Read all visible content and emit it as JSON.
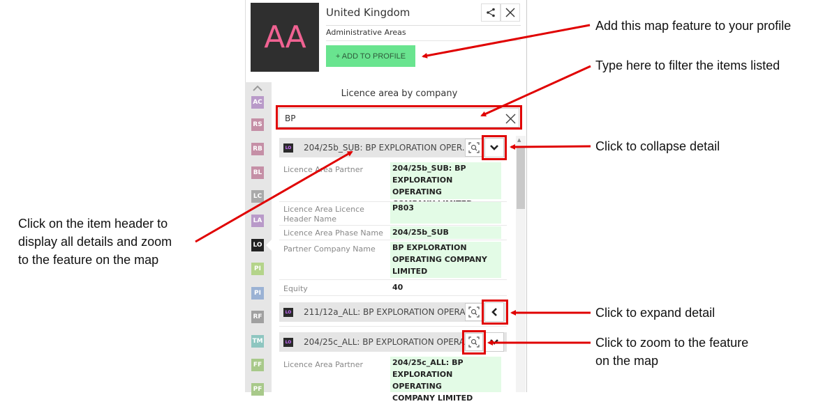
{
  "header": {
    "thumbnail_text": "AA",
    "title": "United Kingdom",
    "subtitle": "Administrative Areas",
    "add_button": "+ ADD TO PROFILE"
  },
  "rail": {
    "items": [
      "AC",
      "RS",
      "RB",
      "BL",
      "LC",
      "LA",
      "LO",
      "PI",
      "PI",
      "RF",
      "TM",
      "FF",
      "PF"
    ],
    "active": "LO"
  },
  "list": {
    "title": "Licence area by company",
    "search_value": "BP",
    "rows": [
      {
        "badge": "LO",
        "title": "204/25b_SUB: BP EXPLORATION OPER...",
        "details": [
          {
            "label": "Licence Area Partner",
            "value_lines": [
              "204/25b_SUB: BP",
              "EXPLORATION OPERATING",
              "COMPANY LIMITED"
            ]
          },
          {
            "label_lines": [
              "Licence Area Licence",
              "Header Name"
            ],
            "value": "P803"
          },
          {
            "label": "Licence Area Phase Name",
            "value": "204/25b_SUB"
          },
          {
            "label": "Partner Company Name",
            "value_lines": [
              "BP EXPLORATION",
              "OPERATING COMPANY",
              "LIMITED"
            ]
          },
          {
            "label": "Equity",
            "value": "40"
          }
        ]
      },
      {
        "badge": "LO",
        "title": "211/12a_ALL: BP EXPLORATION OPERA..."
      },
      {
        "badge": "LO",
        "title": "204/25c_ALL: BP EXPLORATION OPERA...",
        "details": [
          {
            "label": "Licence Area Partner",
            "value_lines": [
              "204/25c_ALL: BP",
              "EXPLORATION OPERATING",
              "COMPANY LIMITED"
            ]
          }
        ]
      }
    ]
  },
  "annotations": {
    "add_profile": "Add this map feature to your profile",
    "filter": "Type here to filter the items listed",
    "collapse": "Click to collapse detail",
    "header_click": [
      "Click on the item header to",
      "display all details and zoom",
      "to the feature on the map"
    ],
    "expand": "Click to expand detail",
    "zoom": [
      "Click to zoom to the feature",
      "on the map"
    ]
  },
  "colors": {
    "add_button": "#69e48f",
    "annotation_red": "#e00000",
    "value_highlight": "#e3fbe6",
    "thumbnail_text": "#f06292"
  }
}
